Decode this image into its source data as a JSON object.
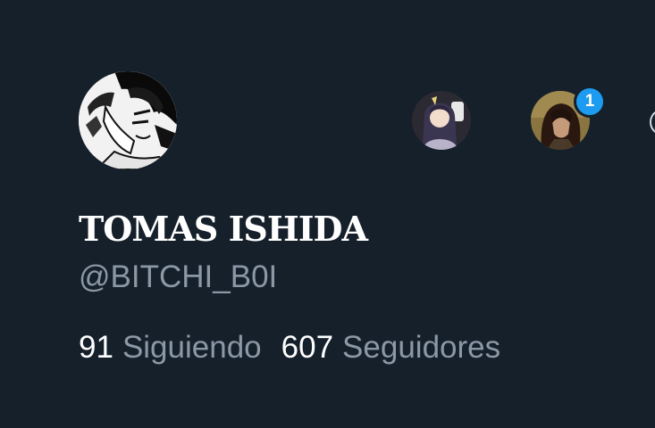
{
  "profile": {
    "display_name": "TOMAS ISHIDA",
    "handle": "@BITCHI_B0I",
    "avatar": "manga-portrait-avatar"
  },
  "stats": {
    "following_count": "91",
    "following_label": "Siguiendo",
    "followers_count": "607",
    "followers_label": "Seguidores"
  },
  "accounts": [
    {
      "avatar": "anime-girl-avatar"
    },
    {
      "avatar": "anime-boy-avatar",
      "notification_badge": "1"
    },
    {
      "avatar": "account-avatar-partial"
    }
  ],
  "colors": {
    "background": "#15202b",
    "primary_text": "#ffffff",
    "secondary_text": "#8b98a5",
    "badge": "#1d9bf0"
  }
}
